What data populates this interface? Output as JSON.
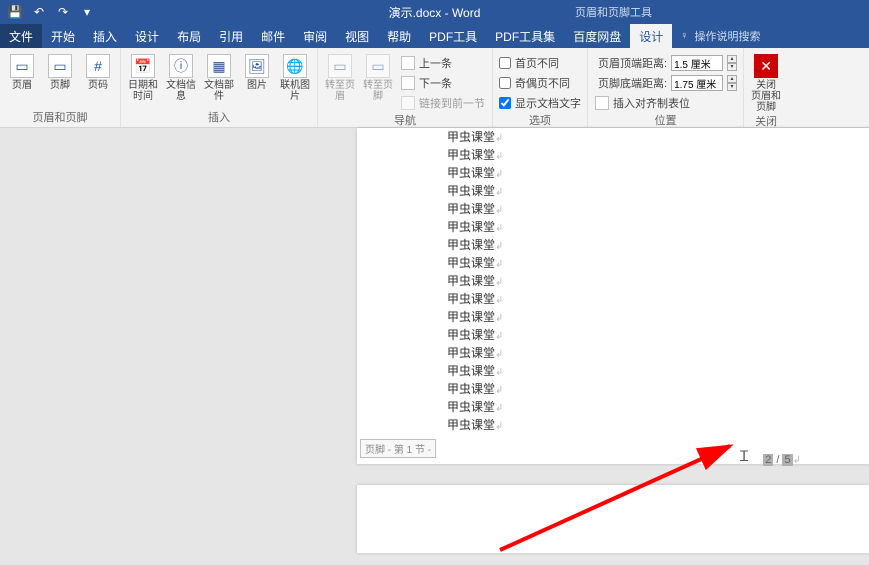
{
  "titlebar": {
    "title": "演示.docx - Word",
    "tool_tab": "页眉和页脚工具"
  },
  "menubar": {
    "items": [
      "文件",
      "开始",
      "插入",
      "设计",
      "布局",
      "引用",
      "邮件",
      "审阅",
      "视图",
      "帮助",
      "PDF工具",
      "PDF工具集",
      "百度网盘",
      "设计"
    ],
    "tell_me": "操作说明搜索"
  },
  "ribbon": {
    "group_hf": {
      "label": "页眉和页脚",
      "items": {
        "header": "页眉",
        "footer": "页脚",
        "page_no": "页码"
      }
    },
    "group_insert": {
      "label": "插入",
      "items": {
        "date": "日期和时间",
        "docinfo": "文档信息",
        "quickparts": "文档部件",
        "picture": "图片",
        "online_pic": "联机图片"
      }
    },
    "group_nav": {
      "label": "导航",
      "items": {
        "gohdr": "转至页眉",
        "goftr": "转至页脚",
        "prev": "上一条",
        "next": "下一条",
        "link": "链接到前一节"
      }
    },
    "group_options": {
      "label": "选项",
      "items": {
        "first_diff": "首页不同",
        "odd_even": "奇偶页不同",
        "show_doc": "显示文档文字"
      }
    },
    "group_position": {
      "label": "位置",
      "items": {
        "hdr_dist": "页眉顶端距离:",
        "ftr_dist": "页脚底端距离:",
        "tabs": "插入对齐制表位"
      },
      "values": {
        "hdr": "1.5 厘米",
        "ftr": "1.75 厘米"
      }
    },
    "group_close": {
      "label": "关闭",
      "btn": "关闭\n页眉和页脚"
    }
  },
  "document": {
    "body_text": "甲虫课堂",
    "footer_tag": "页脚 - 第 1 节 -",
    "page_indicator": {
      "current": "2",
      "sep": " / ",
      "total": "5"
    }
  }
}
